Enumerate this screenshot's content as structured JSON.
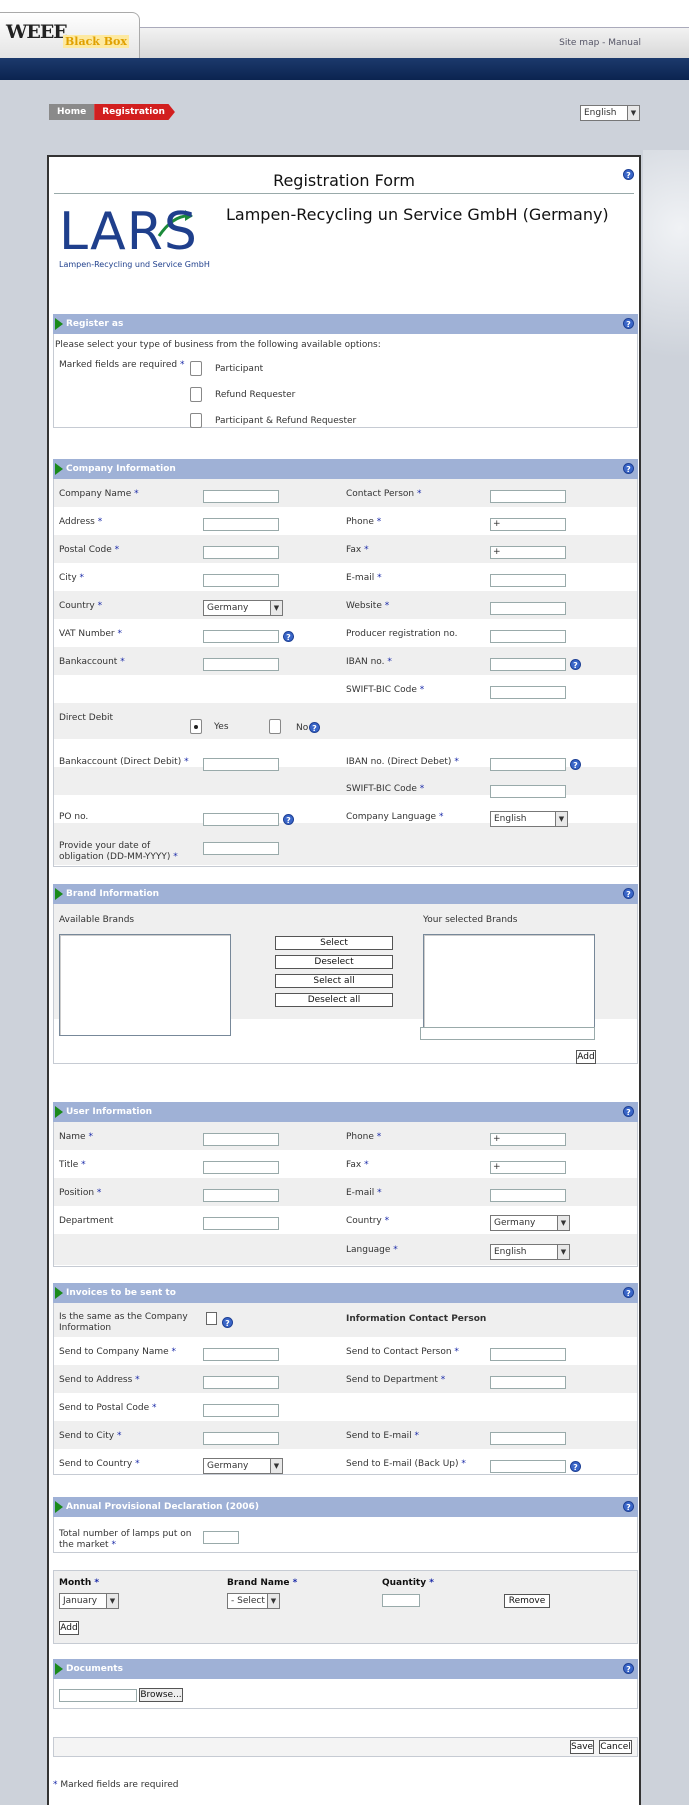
{
  "header": {
    "logo_main": "WEEE",
    "logo_sub": "Black Box",
    "links": [
      "Site map",
      "Manual"
    ],
    "link_sep": " - ",
    "language": "English"
  },
  "breadcrumb": {
    "home": "Home",
    "current": "Registration"
  },
  "form": {
    "title": "Registration Form",
    "company_name": "Lampen-Recycling un Service GmbH (Germany)",
    "logo_text": "LARS",
    "logo_sub": "Lampen-Recycling und Service GmbH",
    "help_glyph": "?"
  },
  "register_as": {
    "title": "Register as",
    "intro": "Please select your type of business from the following available options:",
    "marked_label": "Marked fields are required",
    "options": [
      "Participant",
      "Refund Requester",
      "Participant & Refund Requester"
    ]
  },
  "company": {
    "title": "Company Information",
    "company_name": "Company Name",
    "contact_person": "Contact Person",
    "address": "Address",
    "phone": "Phone",
    "phone_value": "+",
    "postal_code": "Postal Code",
    "fax": "Fax",
    "fax_value": "+",
    "city": "City",
    "email": "E-mail",
    "country": "Country",
    "country_value": "Germany",
    "website": "Website",
    "vat": "VAT Number",
    "producer_reg": "Producer registration no.",
    "bankaccount": "Bankaccount",
    "iban": "IBAN no.",
    "swift": "SWIFT-BIC Code",
    "direct_debit": "Direct Debit",
    "yes": "Yes",
    "no": "No",
    "bankaccount_dd": "Bankaccount (Direct Debit)",
    "iban_dd": "IBAN no. (Direct Debet)",
    "swift_dd": "SWIFT-BIC Code",
    "po": "PO no.",
    "company_language": "Company Language",
    "language_value": "English",
    "obligation": "Provide your date of obligation (DD-MM-YYYY)"
  },
  "brand": {
    "title": "Brand Information",
    "available": "Available Brands",
    "selected": "Your selected Brands",
    "select": "Select",
    "deselect": "Deselect",
    "select_all": "Select all",
    "deselect_all": "Deselect all",
    "add": "Add"
  },
  "user": {
    "title": "User Information",
    "name": "Name",
    "phone": "Phone",
    "phone_value": "+",
    "title_field": "Title",
    "fax": "Fax",
    "fax_value": "+",
    "position": "Position",
    "email": "E-mail",
    "department": "Department",
    "country": "Country",
    "country_value": "Germany",
    "language": "Language",
    "language_value": "English"
  },
  "invoice": {
    "title": "Invoices to be sent to",
    "same_as": "Is the same as the Company Information",
    "info_contact": "Information Contact Person",
    "company_name": "Send to Company Name",
    "contact_person": "Send to Contact Person",
    "address": "Send to Address",
    "department": "Send to Department",
    "postal": "Send to Postal Code",
    "city": "Send to City",
    "email": "Send to E-mail",
    "country": "Send to Country",
    "country_value": "Germany",
    "email_backup": "Send to E-mail (Back Up)"
  },
  "annual": {
    "title": "Annual Provisional Declaration (2006)",
    "total": "Total number of lamps put on the market",
    "month": "Month",
    "month_value": "January",
    "brand_name": "Brand Name",
    "brand_value": "- Select -",
    "quantity": "Quantity",
    "remove": "Remove",
    "add": "Add"
  },
  "documents": {
    "title": "Documents",
    "browse": "Browse..."
  },
  "footer": {
    "save": "Save",
    "cancel": "Cancel",
    "required_note": "Marked fields are required"
  }
}
